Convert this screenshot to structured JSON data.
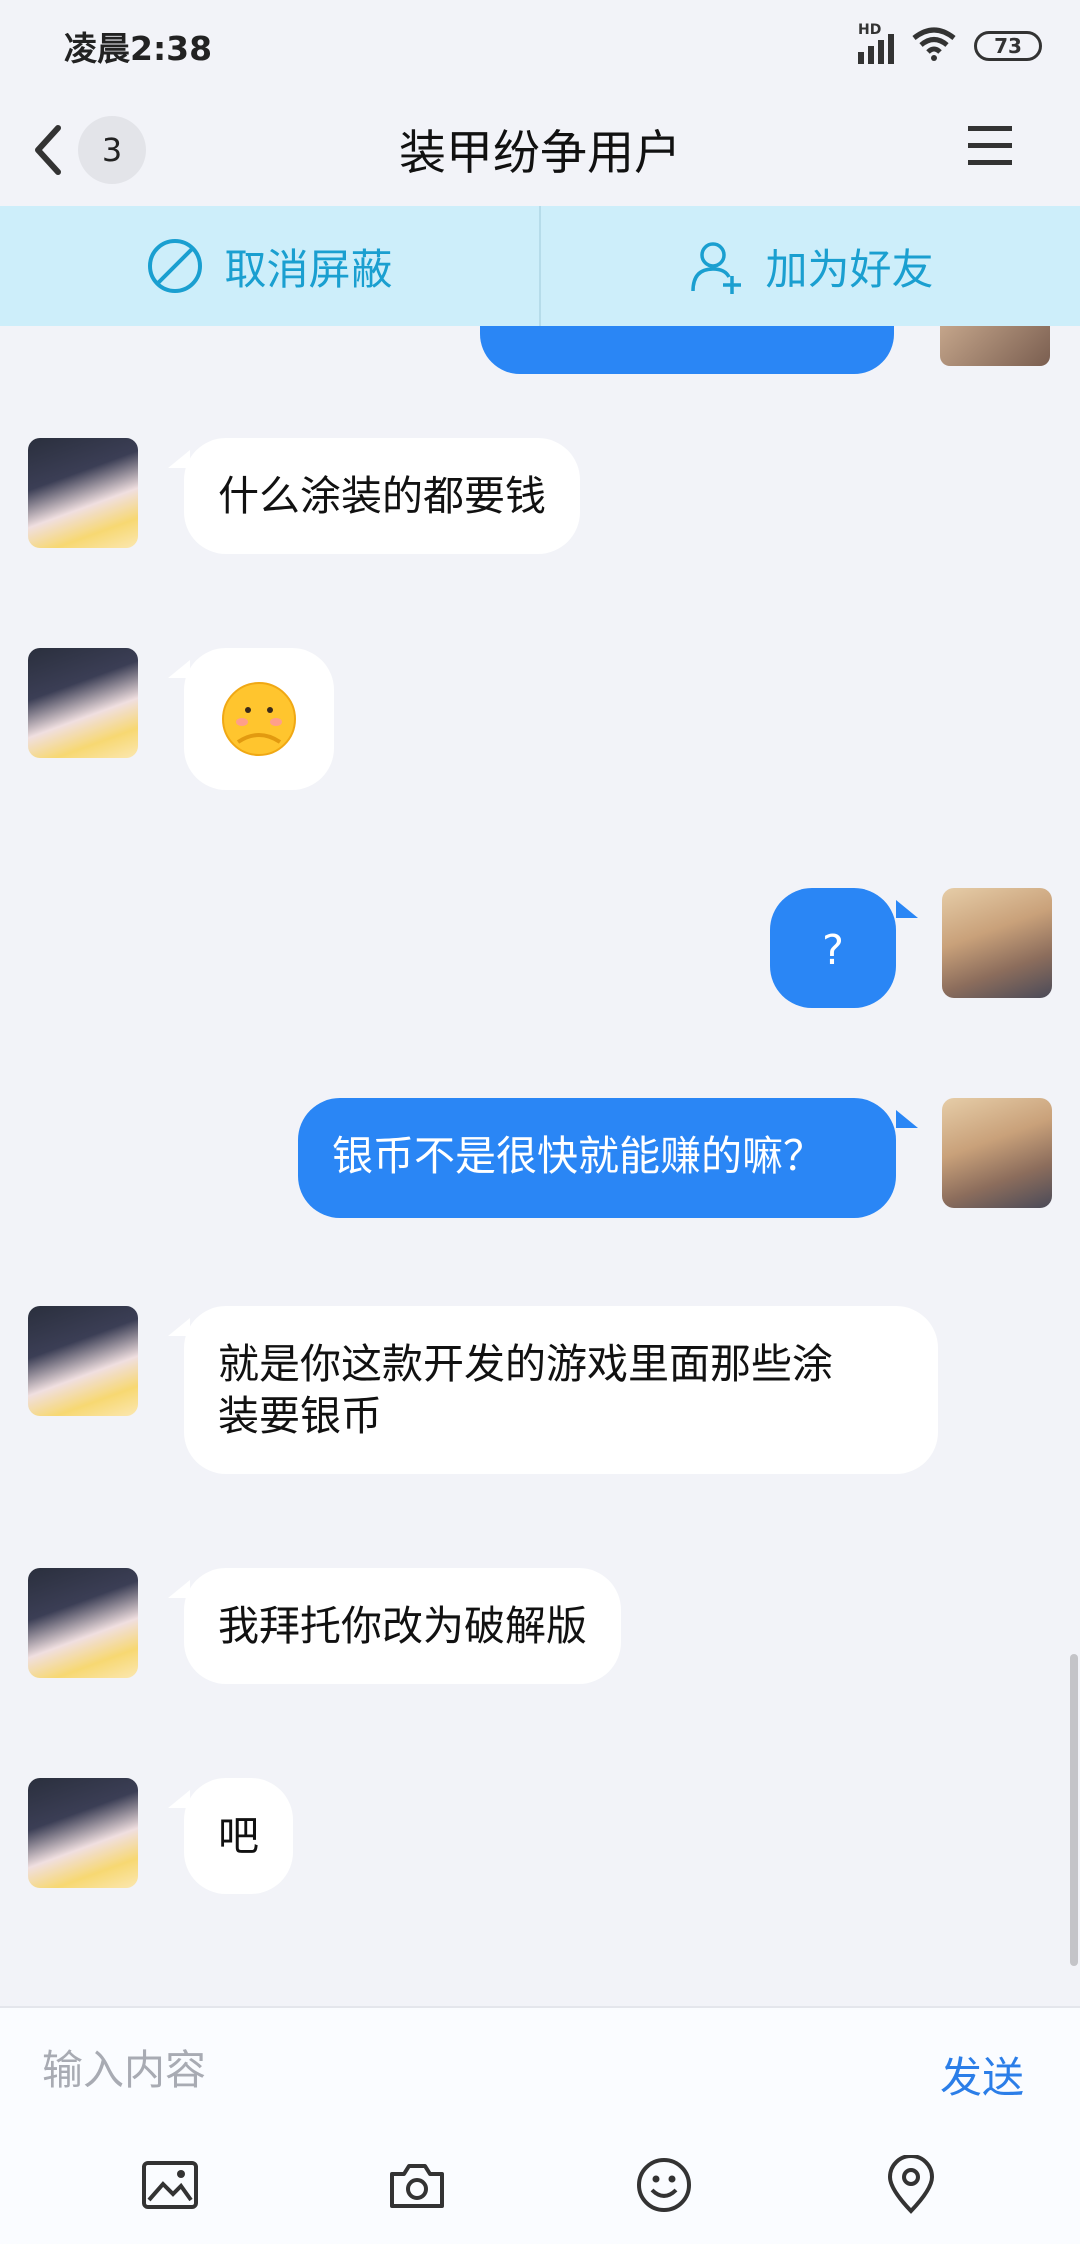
{
  "status_bar": {
    "time": "凌晨2:38",
    "battery": "73",
    "signal_label": "HD"
  },
  "header": {
    "back_count": "3",
    "title": "装甲纷争用户"
  },
  "actions": [
    {
      "label": "取消屏蔽",
      "icon": "unblock-icon"
    },
    {
      "label": "加为好友",
      "icon": "add-friend-icon"
    }
  ],
  "messages": [
    {
      "from": "other",
      "text": "什么涂装的都要钱"
    },
    {
      "from": "other",
      "type": "sticker",
      "icon": "shy-face-emoji"
    },
    {
      "from": "self",
      "text": "?"
    },
    {
      "from": "self",
      "text": "银币不是很快就能赚的嘛？"
    },
    {
      "from": "other",
      "text_line1": "就是你这款开发的游戏里面那些涂",
      "text_line2": "装要银币"
    },
    {
      "from": "other",
      "text": "我拜托你改为破解版"
    },
    {
      "from": "other",
      "text": "吧"
    }
  ],
  "input": {
    "placeholder": "输入内容",
    "send_label": "发送"
  },
  "toolbar": [
    "image-icon",
    "camera-icon",
    "emoji-icon",
    "location-icon"
  ],
  "colors": {
    "accent": "#2a86f5",
    "action_bar": "#cdeefa",
    "action_text": "#1a9fd0",
    "background": "#f2f3f8"
  }
}
